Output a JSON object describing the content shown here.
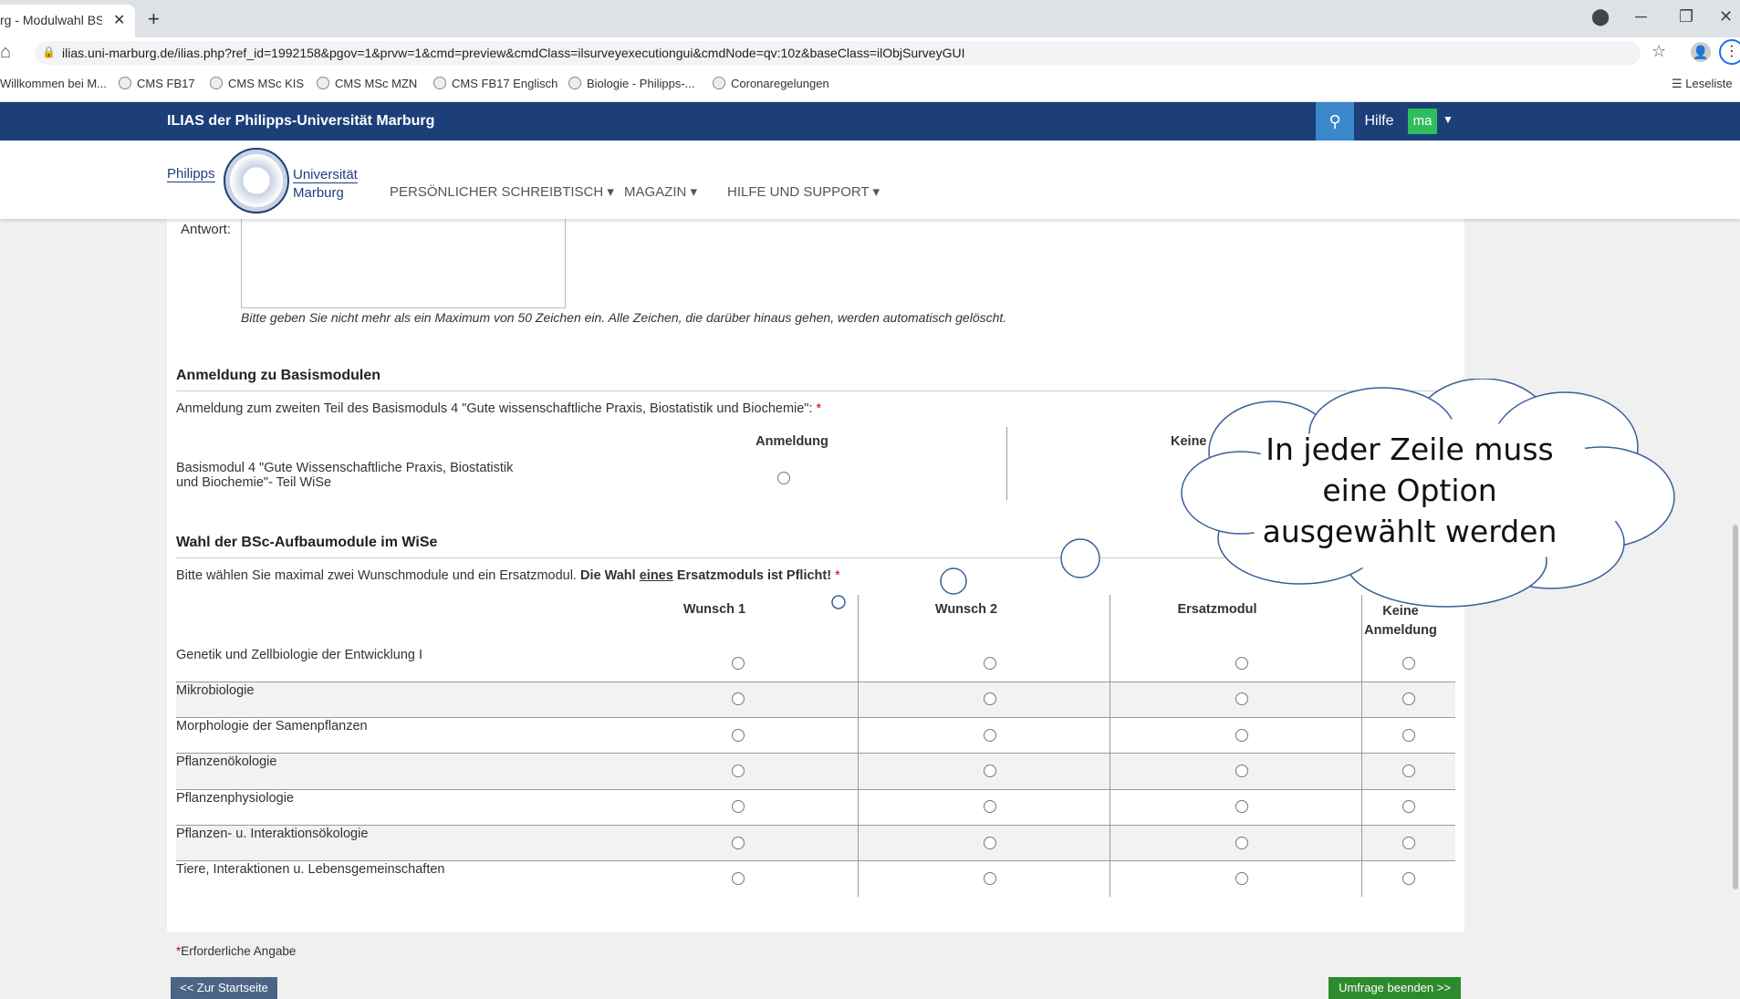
{
  "browser": {
    "tab_title": "rg - Modulwahl BSc B",
    "url": "ilias.uni-marburg.de/ilias.php?ref_id=1992158&pgov=1&prvw=1&cmd=preview&cmdClass=ilsurveyexecutiongui&cmdNode=qv:10z&baseClass=ilObjSurveyGUI",
    "bookmarks": [
      "Willkommen bei M...",
      "CMS FB17",
      "CMS MSc KIS",
      "CMS MSc MZN",
      "CMS FB17 Englisch",
      "Biologie - Philipps-...",
      "Coronaregelungen"
    ],
    "reading_list": "Leseliste"
  },
  "ilias": {
    "title": "ILIAS der Philipps-Universität Marburg",
    "help_label": "Hilfe",
    "user_initials": "ma",
    "logo_left": "Philipps",
    "logo_right_1": "Universität",
    "logo_right_2": "Marburg",
    "nav": [
      "PERSÖNLICHER SCHREIBTISCH ▾",
      "MAGAZIN ▾",
      "HILFE UND SUPPORT ▾"
    ]
  },
  "answer": {
    "label": "Antwort:",
    "hint": "Bitte geben Sie nicht mehr als ein Maximum von 50 Zeichen ein. Alle Zeichen, die darüber hinaus gehen, werden automatisch gelöscht."
  },
  "basis": {
    "heading": "Anmeldung zu Basismodulen",
    "question": "Anmeldung zum zweiten Teil des Basismoduls 4 \"Gute wissenschaftliche Praxis, Biostatistik und Biochemie\": ",
    "col1": "Anmeldung",
    "col2": "Keine A",
    "row_label_1": "Basismodul 4 \"Gute Wissenschaftliche Praxis, Biostatistik",
    "row_label_2": "und Biochemie\"- Teil WiSe"
  },
  "aufbau": {
    "heading": "Wahl der BSc-Aufbaumodule im WiSe",
    "question_plain": "Bitte wählen Sie maximal zwei Wunschmodule und ein Ersatzmodul. ",
    "question_bold_1": "Die Wahl ",
    "question_underline": "eines",
    "question_bold_2": " Ersatzmoduls ist Pflicht!",
    "columns": [
      "Wunsch 1",
      "Wunsch 2",
      "Ersatzmodul",
      "Keine Anmeldung"
    ],
    "rows": [
      "Genetik und Zellbiologie der Entwicklung I",
      "Mikrobiologie",
      "Morphologie der Samenpflanzen",
      "Pflanzenökologie",
      "Pflanzenphysiologie",
      "Pflanzen- u. Interaktionsökologie",
      "Tiere, Interaktionen u. Lebensgemeinschaften"
    ]
  },
  "footer": {
    "required_note": "Erforderliche Angabe",
    "back_button": "<< Zur Startseite",
    "finish_button": "Umfrage beenden >>"
  },
  "callout": {
    "line1": "In jeder Zeile muss",
    "line2": "eine Option",
    "line3": "ausgewählt werden"
  }
}
